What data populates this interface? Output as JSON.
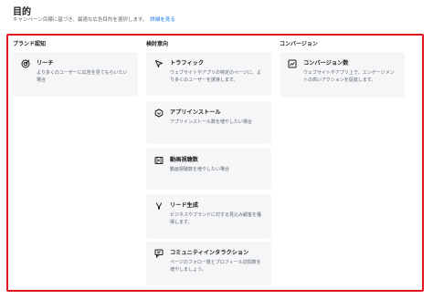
{
  "header": {
    "title": "目的",
    "subtitle": "キャンペーン目標に基づき、最適な広告目的を選択します。",
    "learn_more": "詳細を見る"
  },
  "columns": [
    {
      "label": "ブランド認知",
      "cards": [
        {
          "title": "リーチ",
          "description": "より多くのユーザーに広告を見てもらいたい場合",
          "icon": "reach-target-icon"
        }
      ]
    },
    {
      "label": "検討意向",
      "cards": [
        {
          "title": "トラフィック",
          "description": "ウェブサイトやアプリの特定のページに、より多くのユーザーを誘導します。",
          "icon": "cursor-arrow-icon"
        },
        {
          "title": "アプリインストール",
          "description": "アプリインストール数を増やしたい場合",
          "icon": "app-box-icon"
        },
        {
          "title": "動画視聴数",
          "description": "動画視聴数を増やしたい場合",
          "icon": "video-film-icon"
        },
        {
          "title": "リード生成",
          "description": "ビジネスやブランドに対する見込み顧客を獲得します。",
          "icon": "lead-funnel-icon"
        },
        {
          "title": "コミュニティインタラクション",
          "description": "ページのフォロー数とプロフィール訪問数を増やしましょう。",
          "icon": "community-chat-icon"
        }
      ]
    },
    {
      "label": "コンバージョン",
      "cards": [
        {
          "title": "コンバージョン数",
          "description": "ウェブサイトやアプリ上で、エンゲージメントの高いアクションを促進します。",
          "icon": "conversion-chart-icon"
        }
      ]
    }
  ],
  "colors": {
    "highlight_border": "#e0141e",
    "card_background": "#f5f6f7",
    "link": "#1877f2"
  }
}
